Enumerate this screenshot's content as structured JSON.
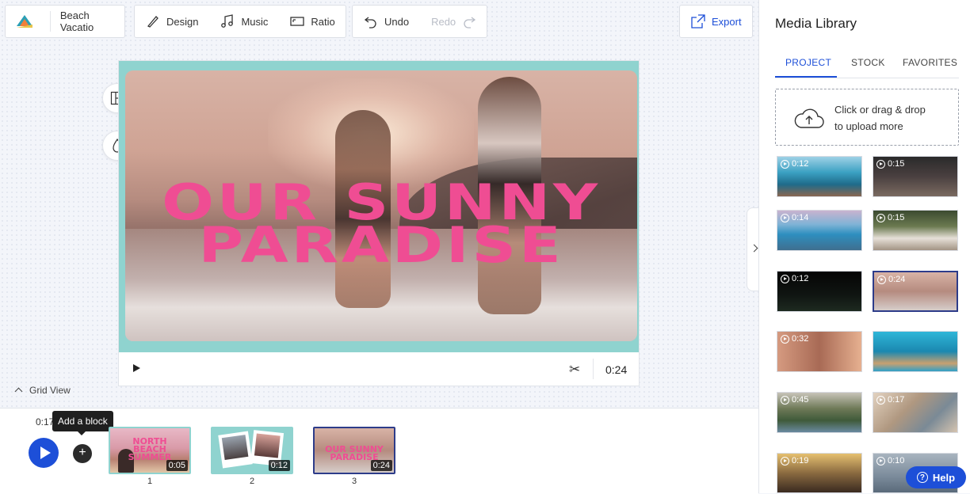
{
  "toolbar": {
    "project_name": "Beach Vacatio",
    "design_label": "Design",
    "music_label": "Music",
    "ratio_label": "Ratio",
    "undo_label": "Undo",
    "redo_label": "Redo",
    "export_label": "Export"
  },
  "preview": {
    "title_line1": "OUR SUNNY",
    "title_line2": "PARADISE",
    "duration": "0:24"
  },
  "grid_view_label": "Grid View",
  "timeline": {
    "current_time": "0:17",
    "tooltip": "Add a block",
    "clips": [
      {
        "number": "1",
        "duration": "0:05",
        "text": [
          "NORTH",
          "BEACH",
          "SUMMER"
        ]
      },
      {
        "number": "2",
        "duration": "0:12",
        "text": []
      },
      {
        "number": "3",
        "duration": "0:24",
        "text": [
          "OUR SUNNY",
          "PARADISE"
        ]
      }
    ]
  },
  "media_library": {
    "title": "Media Library",
    "tabs": [
      "PROJECT",
      "STOCK",
      "FAVORITES"
    ],
    "active_tab": "PROJECT",
    "upload_line1": "Click or drag & drop",
    "upload_line2": "to upload more",
    "thumbnails": [
      {
        "duration": "0:12"
      },
      {
        "duration": "0:15"
      },
      {
        "duration": "0:14"
      },
      {
        "duration": "0:15"
      },
      {
        "duration": "0:12"
      },
      {
        "duration": "0:24"
      },
      {
        "duration": "0:32"
      },
      {
        "duration": ""
      },
      {
        "duration": "0:45"
      },
      {
        "duration": "0:17"
      },
      {
        "duration": "0:19"
      },
      {
        "duration": "0:10"
      }
    ]
  },
  "help_label": "Help",
  "colors": {
    "accent": "#1d4fd8",
    "title_pink": "#ef4d93",
    "frame_teal": "#8fd3cf",
    "selected_border": "#2d3c8a"
  }
}
